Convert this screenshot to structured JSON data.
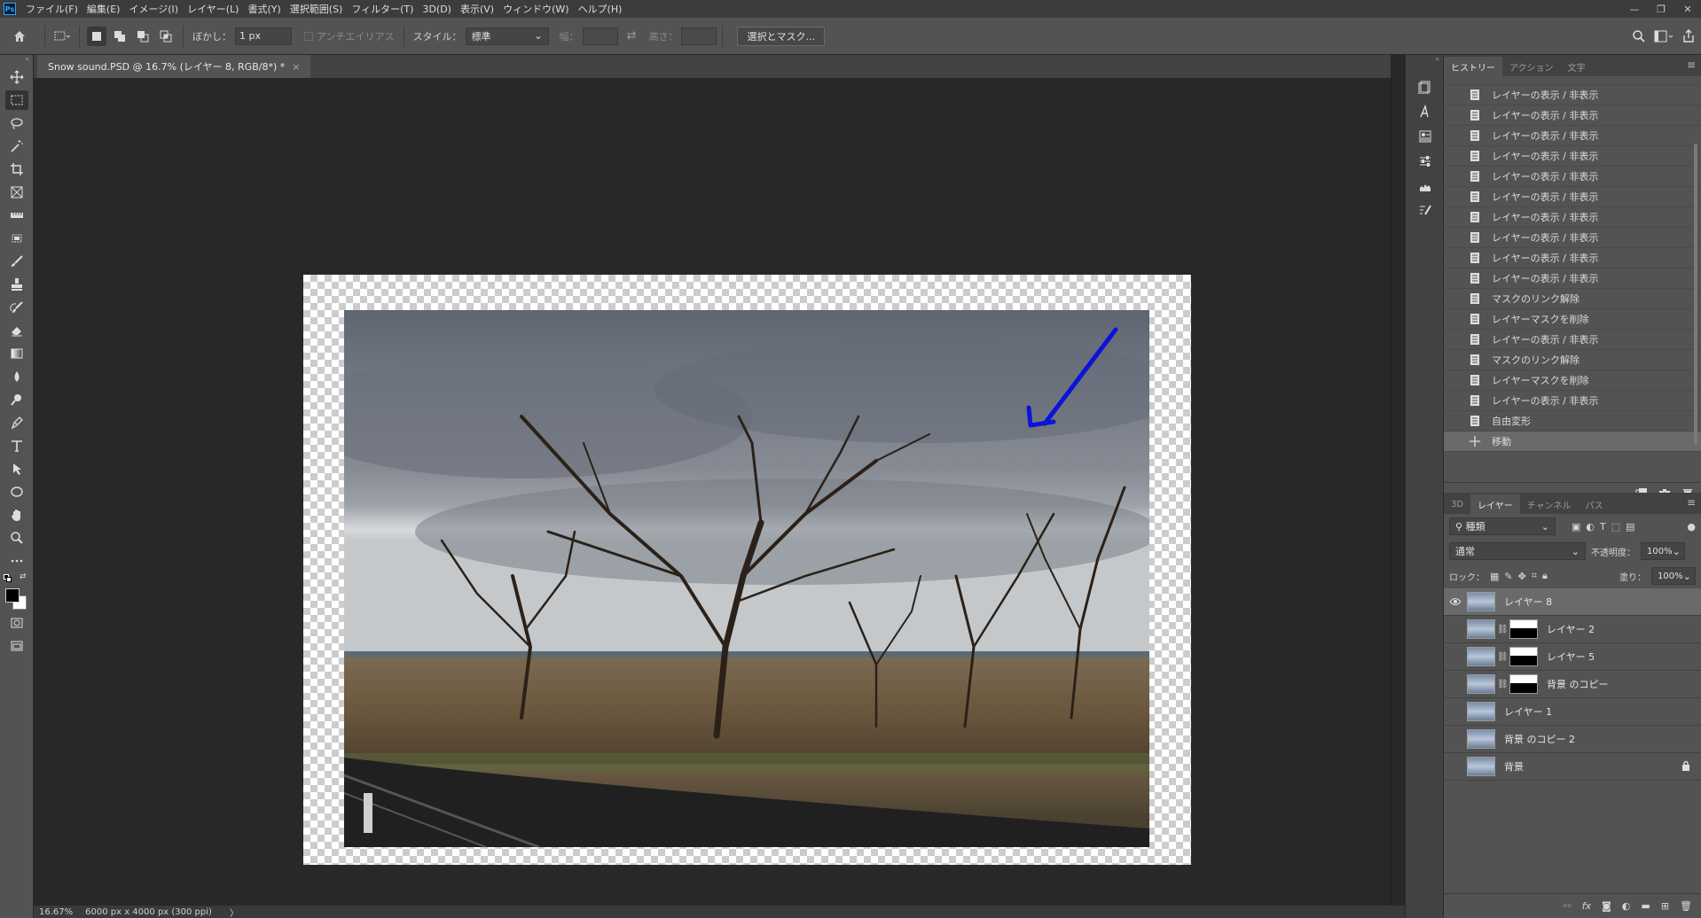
{
  "app": {
    "logo": "Ps",
    "menu": [
      "ファイル(F)",
      "編集(E)",
      "イメージ(I)",
      "レイヤー(L)",
      "書式(Y)",
      "選択範囲(S)",
      "フィルター(T)",
      "3D(D)",
      "表示(V)",
      "ウィンドウ(W)",
      "ヘルプ(H)"
    ],
    "window_controls": [
      "—",
      "❐",
      "✕"
    ]
  },
  "options": {
    "feather_label": "ぼかし：",
    "feather_value": "1 px",
    "antialias_label": "アンチエイリアス",
    "style_label": "スタイル：",
    "style_value": "標準",
    "width_label": "幅：",
    "height_label": "高さ：",
    "select_mask_label": "選択とマスク..."
  },
  "document": {
    "tab_title": "Snow sound.PSD @ 16.7% (レイヤー 8, RGB/8*) *",
    "tab_close": "×",
    "zoom": "16.67%",
    "dimensions": "6000 px x 4000 px (300 ppi)",
    "status_arrow": "〉"
  },
  "panels": {
    "history_tabs": [
      "ヒストリー",
      "アクション",
      "文字"
    ],
    "history_items": [
      "レイヤーの表示 / 非表示",
      "レイヤーの表示 / 非表示",
      "レイヤーの表示 / 非表示",
      "レイヤーの表示 / 非表示",
      "レイヤーの表示 / 非表示",
      "レイヤーの表示 / 非表示",
      "レイヤーの表示 / 非表示",
      "レイヤーの表示 / 非表示",
      "レイヤーの表示 / 非表示",
      "レイヤーの表示 / 非表示",
      "マスクのリンク解除",
      "レイヤーマスクを削除",
      "レイヤーの表示 / 非表示",
      "マスクのリンク解除",
      "レイヤーマスクを削除",
      "レイヤーの表示 / 非表示",
      "自由変形",
      "移動"
    ],
    "layers_tabs": [
      "3D",
      "レイヤー",
      "チャンネル",
      "パス"
    ],
    "kind_filter": "種類",
    "blend_mode": "通常",
    "opacity_label": "不透明度：",
    "opacity_value": "100%",
    "lock_label": "ロック：",
    "fill_label": "塗り：",
    "fill_value": "100%",
    "layers": [
      {
        "name": "レイヤー 8",
        "visible": true,
        "selected": true,
        "mask": false
      },
      {
        "name": "レイヤー 2",
        "visible": false,
        "selected": false,
        "mask": true
      },
      {
        "name": "レイヤー 5",
        "visible": false,
        "selected": false,
        "mask": true
      },
      {
        "name": "背景 のコピー",
        "visible": false,
        "selected": false,
        "mask": true
      },
      {
        "name": "レイヤー 1",
        "visible": false,
        "selected": false,
        "mask": false
      },
      {
        "name": "背景 のコピー 2",
        "visible": false,
        "selected": false,
        "mask": false
      },
      {
        "name": "背景",
        "visible": false,
        "selected": false,
        "mask": false,
        "locked": true
      }
    ]
  },
  "colors": {
    "annotation_arrow": "#0a14d8",
    "accent": "#31a8ff"
  }
}
